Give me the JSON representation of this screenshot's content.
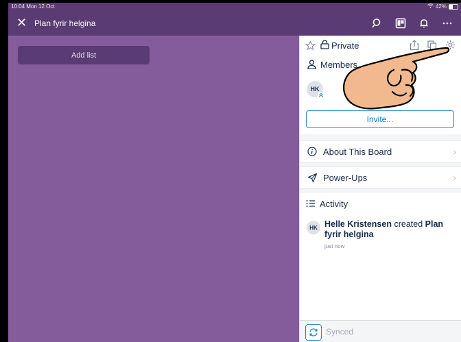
{
  "status_bar": {
    "time": "10:04",
    "date": "Mon 12 Oct",
    "battery": "42%",
    "battery_level": 0.42
  },
  "header": {
    "title": "Plan fyrir helgina"
  },
  "board": {
    "add_list_label": "Add list"
  },
  "panel": {
    "visibility_label": "Private",
    "members_label": "Members",
    "member_initials": "HK",
    "invite_label": "Invite...",
    "about_label": "About This Board",
    "powerups_label": "Power-Ups",
    "activity_label": "Activity",
    "activity": {
      "avatar": "HK",
      "user": "Helle Kristensen",
      "action": "created",
      "target": "Plan fyrir helgina",
      "time": "just now"
    },
    "footer": {
      "sync_label": "Synced"
    }
  },
  "colors": {
    "board_bg": "#845c9c",
    "header_bg": "#5b3b73",
    "accent": "#0a7ac0"
  }
}
